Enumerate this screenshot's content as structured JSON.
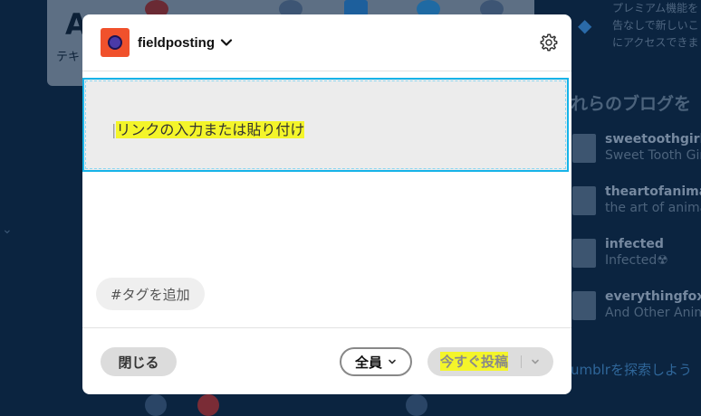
{
  "background": {
    "card_title": "A",
    "card_subtitle": "テキ",
    "promo_lines": [
      "プレミアム機能を",
      "告なしで新しいこ",
      "にアクセスできま"
    ],
    "recommend_heading": "れらのブログを",
    "blogs": [
      {
        "name": "sweetoothgirl",
        "subtitle": "Sweet Tooth Girl"
      },
      {
        "name": "theartofanimatic",
        "subtitle": "the art of animat"
      },
      {
        "name": "infected",
        "subtitle": "Infected☢"
      },
      {
        "name": "everythingfox",
        "subtitle": "And Other Anima"
      }
    ],
    "explore_link": "umblrを探索しよう"
  },
  "modal": {
    "blog_name": "fieldposting",
    "link_placeholder": "リンクの入力または貼り付け",
    "tag_button": "#タグを追加",
    "close_button": "閉じる",
    "audience_button": "全員",
    "post_button": "今すぐ投稿"
  },
  "colors": {
    "overlay_background": "#0b2440",
    "link_focus_border": "#16b3e8",
    "highlight": "#f4f52a",
    "avatar": "#f0512c"
  },
  "icons": {
    "header_chevron": "chevron-down-icon",
    "settings": "gear-icon",
    "audience_chevron": "chevron-down-icon",
    "post_options": "chevron-down-icon"
  }
}
